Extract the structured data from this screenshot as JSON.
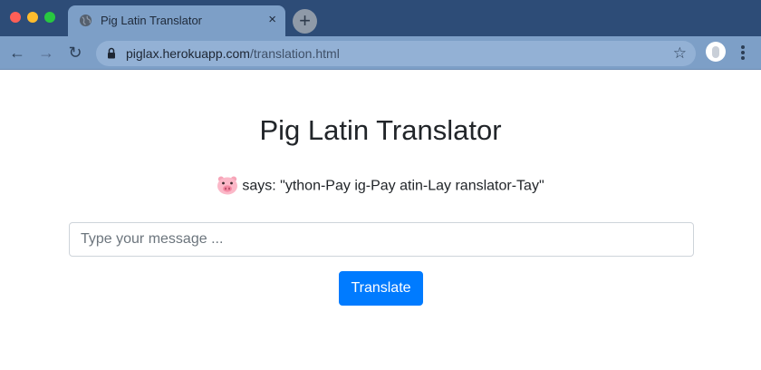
{
  "browser": {
    "tab": {
      "title": "Pig Latin Translator",
      "close_label": "×"
    },
    "new_tab_label": "+",
    "nav": {
      "back": "←",
      "forward": "→",
      "reload": "↻"
    },
    "address_bar": {
      "host": "piglax.herokuapp.com",
      "path": "/translation.html"
    },
    "bookmark_icon": "star-icon",
    "colors": {
      "chrome_top": "#2d4c77",
      "chrome_tab": "#7d9fc7"
    }
  },
  "main": {
    "title": "Pig Latin Translator",
    "says_text": "says: \"ython-Pay ig-Pay atin-Lay ranslator-Tay\"",
    "input": {
      "value": "",
      "placeholder": "Type your message ..."
    },
    "translate_button": "Translate",
    "colors": {
      "primary": "#007bff",
      "text": "#212529"
    }
  }
}
